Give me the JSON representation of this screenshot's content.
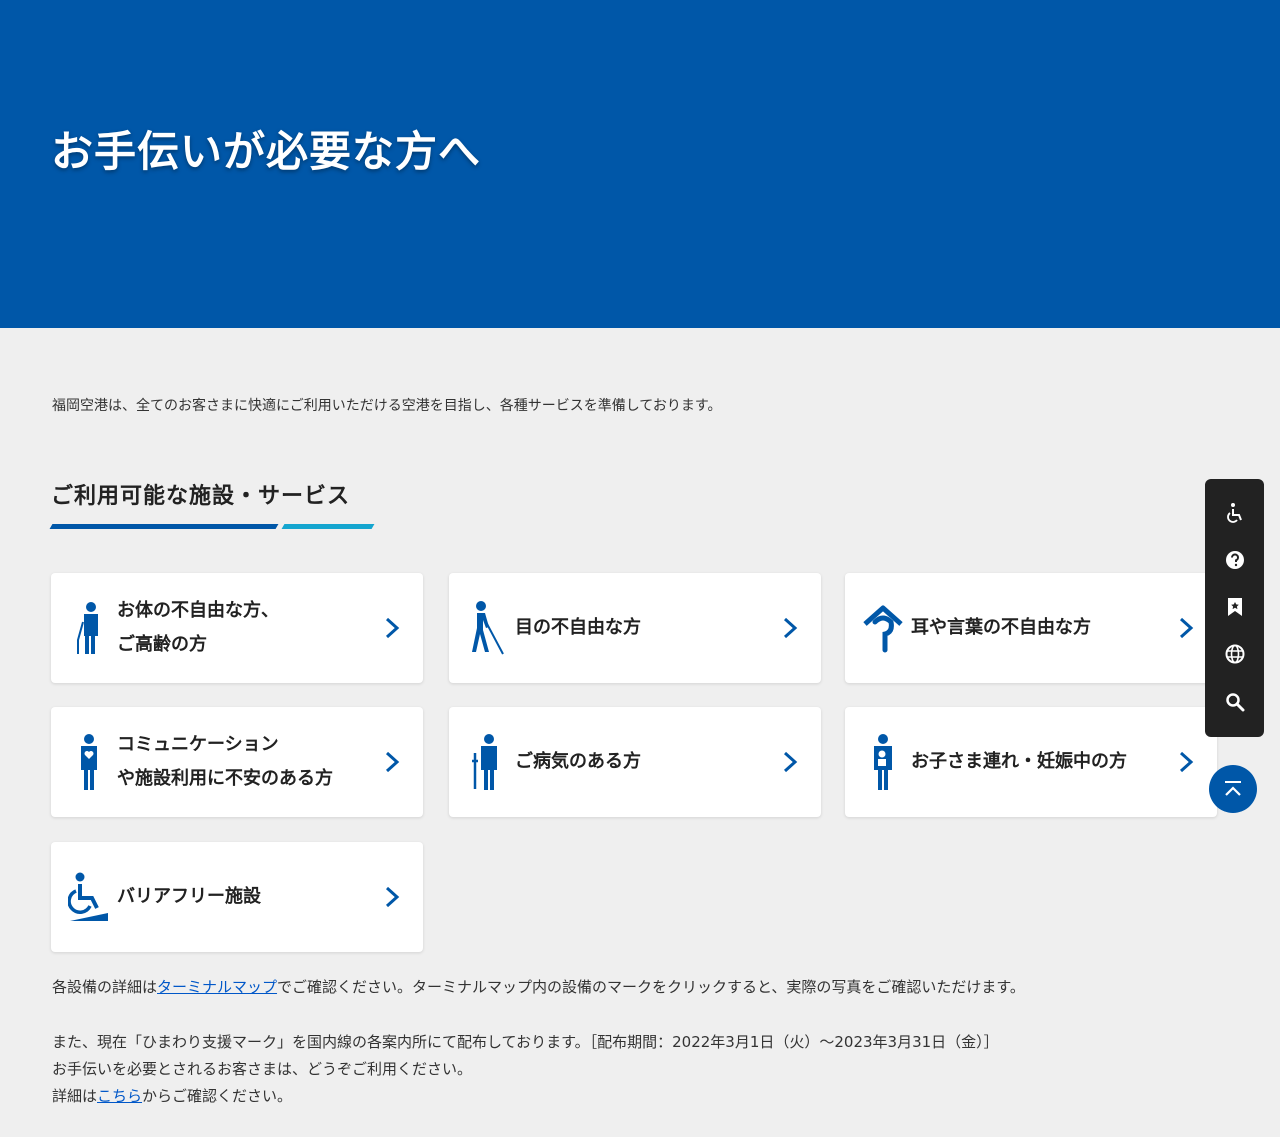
{
  "hero": {
    "title": "お手伝いが必要な方へ"
  },
  "intro": "福岡空港は、全てのお客さまに快適にご利用いただける空港を目指し、各種サービスを準備しております。",
  "section": {
    "title": "ご利用可能な施設・サービス"
  },
  "cards": [
    {
      "label": "お体の不自由な方、\nご高齢の方",
      "icon": "elderly-person-cane-icon"
    },
    {
      "label": "目の不自由な方",
      "icon": "visually-impaired-person-icon"
    },
    {
      "label": "耳や言葉の不自由な方",
      "icon": "ear-symbol-icon"
    },
    {
      "label": "コミュニケーション\nや施設利用に不安のある方",
      "icon": "person-heart-icon"
    },
    {
      "label": "ご病気のある方",
      "icon": "person-crutch-icon"
    },
    {
      "label": "お子さま連れ・妊娠中の方",
      "icon": "parent-with-child-icon"
    },
    {
      "label": "バリアフリー施設",
      "icon": "wheelchair-ramp-icon"
    }
  ],
  "notes": {
    "map_prefix": "各設備の詳細は",
    "map_link": "ターミナルマップ",
    "map_suffix": "でご確認ください。ターミナルマップ内の設備のマークをクリックすると、実際の写真をご確認いただけます。",
    "himawari": "また、現在「ひまわり支援マーク」を国内線の各案内所にて配布しております。［配布期間：2022年3月1日（火）～2023年3月31日（金）］",
    "use": "お手伝いを必要とされるお客さまは、どうぞご利用ください。",
    "detail_prefix": "詳細は",
    "detail_link": "こちら",
    "detail_suffix": "からご確認ください。"
  },
  "sidebar": [
    "accessibility-icon",
    "help-icon",
    "bookmark-icon",
    "globe-icon",
    "search-icon"
  ],
  "scroll_top": "scroll-to-top-icon",
  "colors": {
    "primary": "#0057a8",
    "accent": "#14a5cf",
    "link": "#0057c8",
    "background": "#efefef"
  }
}
